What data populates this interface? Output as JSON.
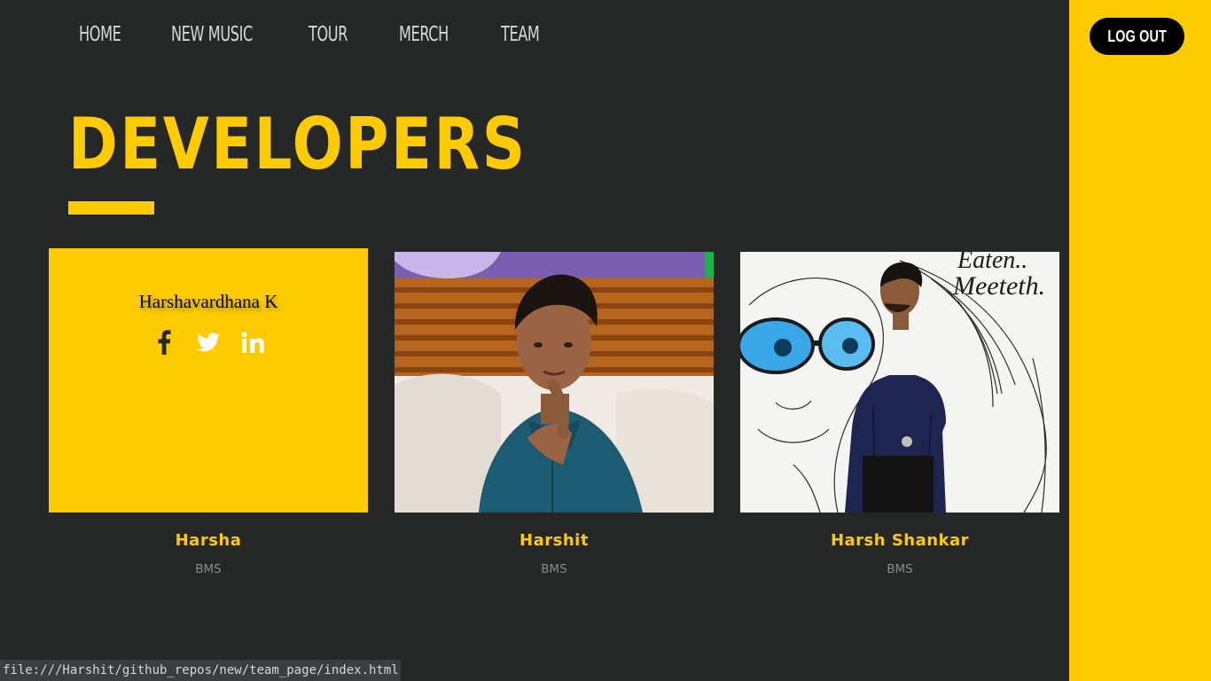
{
  "nav": {
    "items": [
      {
        "label": "HOME"
      },
      {
        "label": "NEW MUSIC"
      },
      {
        "label": "TOUR"
      },
      {
        "label": "MERCH"
      },
      {
        "label": "TEAM"
      }
    ]
  },
  "sidebar": {
    "logout_label": "LOG OUT"
  },
  "page": {
    "title": "DEVELOPERS"
  },
  "developers": [
    {
      "card_title": "Harshavardhana K",
      "name": "Harsha",
      "org": "BMS",
      "socials": [
        "facebook-icon",
        "twitter-icon",
        "linkedin-icon"
      ]
    },
    {
      "name": "Harshit",
      "org": "BMS"
    },
    {
      "name": "Harsh Shankar",
      "org": "BMS",
      "photo_caption": "Eaten... Meeteth"
    }
  ],
  "status_bar": {
    "url": "file:///Harshit/github_repos/new/team_page/index.html"
  },
  "colors": {
    "accent": "#fecb00",
    "background": "#262828",
    "button": "#000000"
  }
}
